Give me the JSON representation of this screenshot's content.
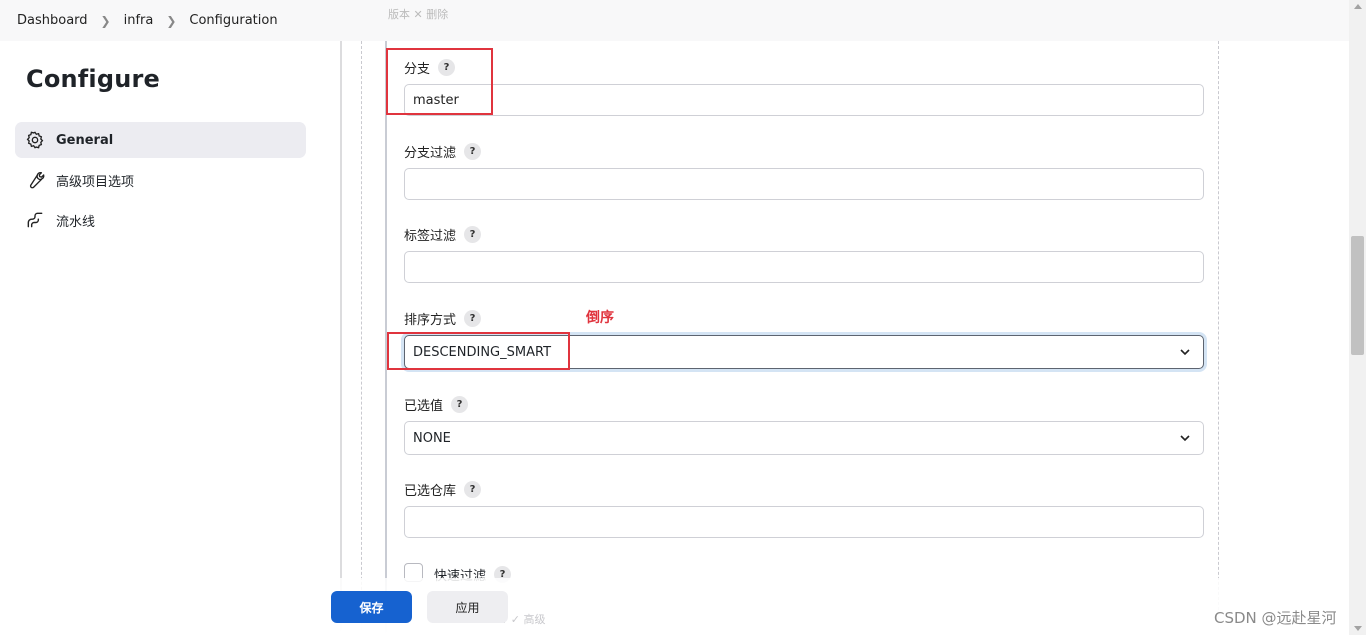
{
  "breadcrumb": {
    "items": [
      "Dashboard",
      "infra",
      "Configuration"
    ]
  },
  "sidebar": {
    "title": "Configure",
    "items": [
      {
        "label": "General",
        "icon": "gear-icon"
      },
      {
        "label": "高级项目选项",
        "icon": "wrench-icon"
      },
      {
        "label": "流水线",
        "icon": "pipeline-icon"
      }
    ]
  },
  "form": {
    "ghost_top": "版本   ✕ 删除",
    "branch": {
      "label": "分支",
      "value": "master"
    },
    "branch_filter": {
      "label": "分支过滤",
      "value": ""
    },
    "tag_filter": {
      "label": "标签过滤",
      "value": ""
    },
    "sort_mode": {
      "label": "排序方式",
      "value": "DESCENDING_SMART",
      "annotation": "倒序"
    },
    "selected_value": {
      "label": "已选值",
      "value": "NONE"
    },
    "selected_repo": {
      "label": "已选仓库",
      "value": ""
    },
    "quick_filter": {
      "label": "快速过滤",
      "checked": false
    },
    "help_glyph": "?"
  },
  "buttons": {
    "save": "保存",
    "apply": "应用"
  },
  "ghost_bottom": "Parameter ✓ 高级",
  "watermark": "CSDN @远赴星河",
  "colors": {
    "primary": "#1662d0",
    "annotation": "#e0343e"
  }
}
